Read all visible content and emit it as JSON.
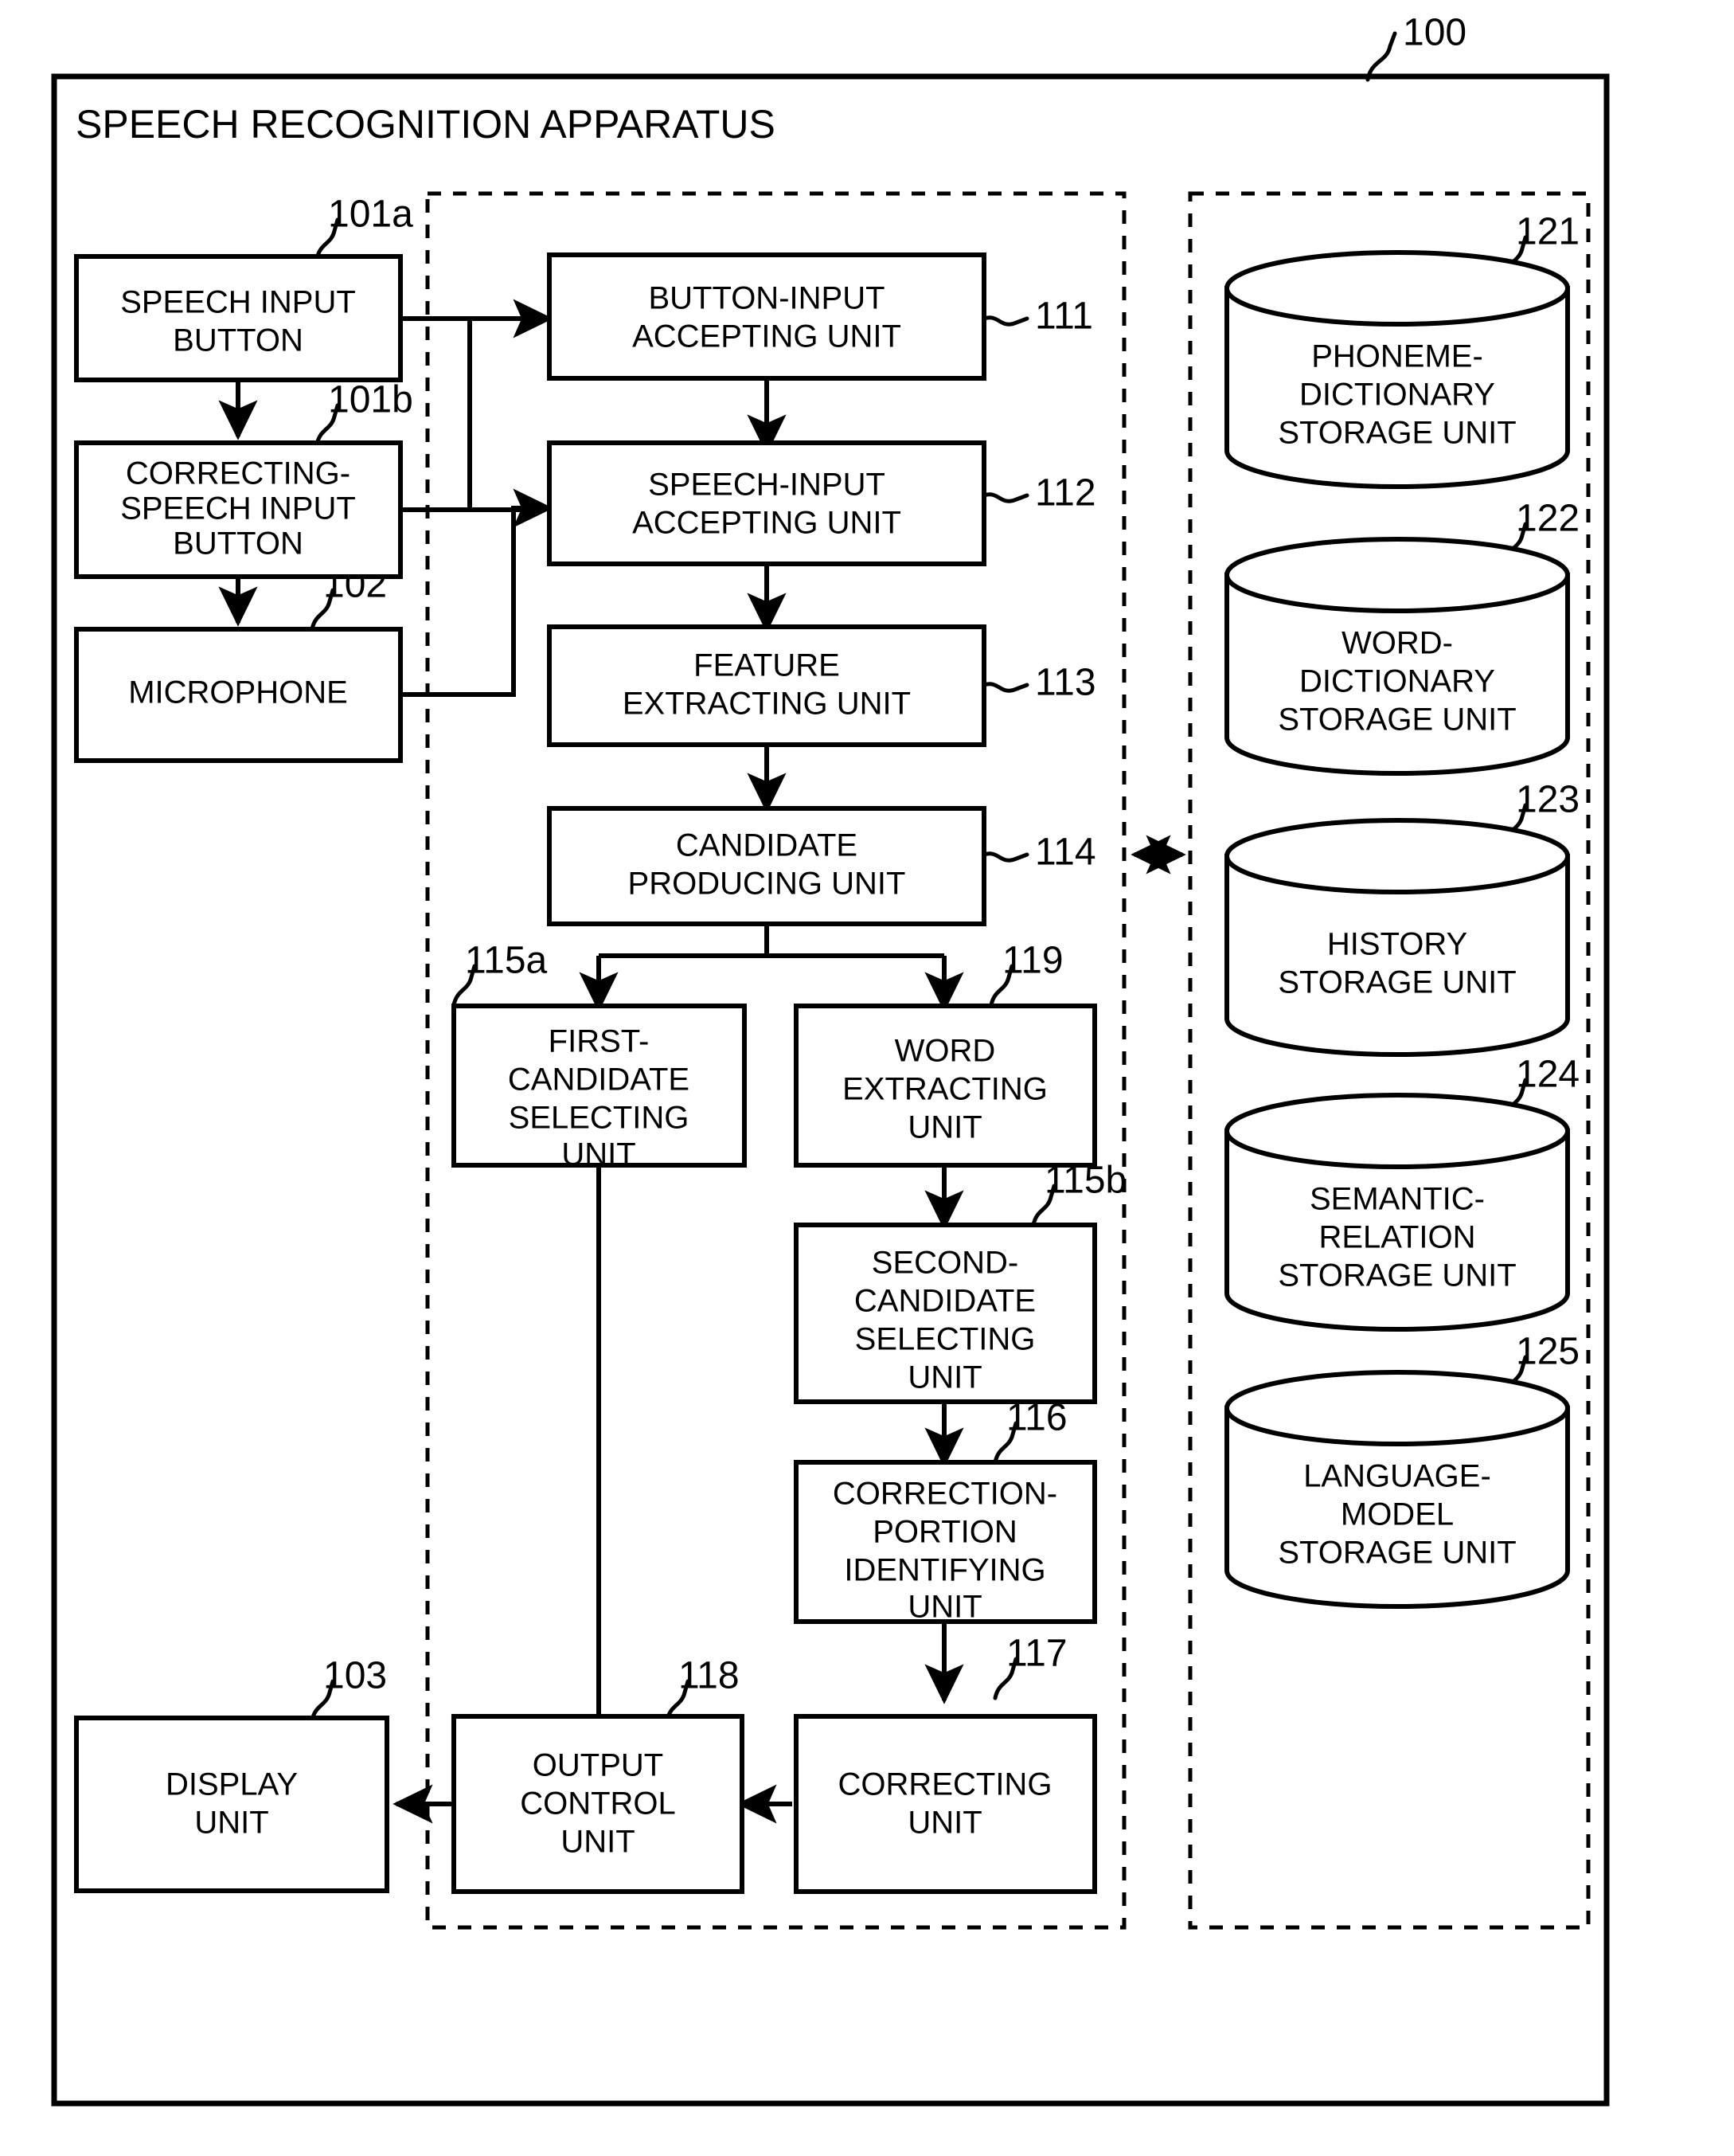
{
  "figure": {
    "title": "SPEECH RECOGNITION APPARATUS",
    "apparatus_ref": "100"
  },
  "input_devices": [
    {
      "ref": "101a",
      "label_lines": [
        "SPEECH INPUT",
        "BUTTON"
      ],
      "name": "speech-input-button"
    },
    {
      "ref": "101b",
      "label_lines": [
        "CORRECTING-",
        "SPEECH INPUT",
        "BUTTON"
      ],
      "name": "correcting-speech-input-button"
    },
    {
      "ref": "102",
      "label_lines": [
        "MICROPHONE"
      ],
      "name": "microphone"
    },
    {
      "ref": "103",
      "label_lines": [
        "DISPLAY",
        "UNIT"
      ],
      "name": "display-unit"
    }
  ],
  "processing_units": [
    {
      "ref": "111",
      "label_lines": [
        "BUTTON-INPUT",
        "ACCEPTING UNIT"
      ],
      "name": "button-input-accepting-unit"
    },
    {
      "ref": "112",
      "label_lines": [
        "SPEECH-INPUT",
        "ACCEPTING UNIT"
      ],
      "name": "speech-input-accepting-unit"
    },
    {
      "ref": "113",
      "label_lines": [
        "FEATURE",
        "EXTRACTING UNIT"
      ],
      "name": "feature-extracting-unit"
    },
    {
      "ref": "114",
      "label_lines": [
        "CANDIDATE",
        "PRODUCING UNIT"
      ],
      "name": "candidate-producing-unit"
    },
    {
      "ref": "115a",
      "label_lines": [
        "FIRST-",
        "CANDIDATE",
        "SELECTING",
        "UNIT"
      ],
      "name": "first-candidate-selecting-unit"
    },
    {
      "ref": "119",
      "label_lines": [
        "WORD",
        "EXTRACTING",
        "UNIT"
      ],
      "name": "word-extracting-unit"
    },
    {
      "ref": "115b",
      "label_lines": [
        "SECOND-",
        "CANDIDATE",
        "SELECTING",
        "UNIT"
      ],
      "name": "second-candidate-selecting-unit"
    },
    {
      "ref": "116",
      "label_lines": [
        "CORRECTION-",
        "PORTION",
        "IDENTIFYING",
        "UNIT"
      ],
      "name": "correction-portion-identifying-unit"
    },
    {
      "ref": "117",
      "label_lines": [
        "CORRECTING",
        "UNIT"
      ],
      "name": "correcting-unit"
    },
    {
      "ref": "118",
      "label_lines": [
        "OUTPUT",
        "CONTROL",
        "UNIT"
      ],
      "name": "output-control-unit"
    }
  ],
  "storage_units": [
    {
      "ref": "121",
      "label_lines": [
        "PHONEME-",
        "DICTIONARY",
        "STORAGE UNIT"
      ],
      "name": "phoneme-dictionary-storage-unit"
    },
    {
      "ref": "122",
      "label_lines": [
        "WORD-",
        "DICTIONARY",
        "STORAGE UNIT"
      ],
      "name": "word-dictionary-storage-unit"
    },
    {
      "ref": "123",
      "label_lines": [
        "HISTORY",
        "STORAGE UNIT"
      ],
      "name": "history-storage-unit"
    },
    {
      "ref": "124",
      "label_lines": [
        "SEMANTIC-",
        "RELATION",
        "STORAGE UNIT"
      ],
      "name": "semantic-relation-storage-unit"
    },
    {
      "ref": "125",
      "label_lines": [
        "LANGUAGE-",
        "MODEL",
        "STORAGE UNIT"
      ],
      "name": "language-model-storage-unit"
    }
  ],
  "colors": {
    "ink": "#000000",
    "paper": "#ffffff"
  }
}
